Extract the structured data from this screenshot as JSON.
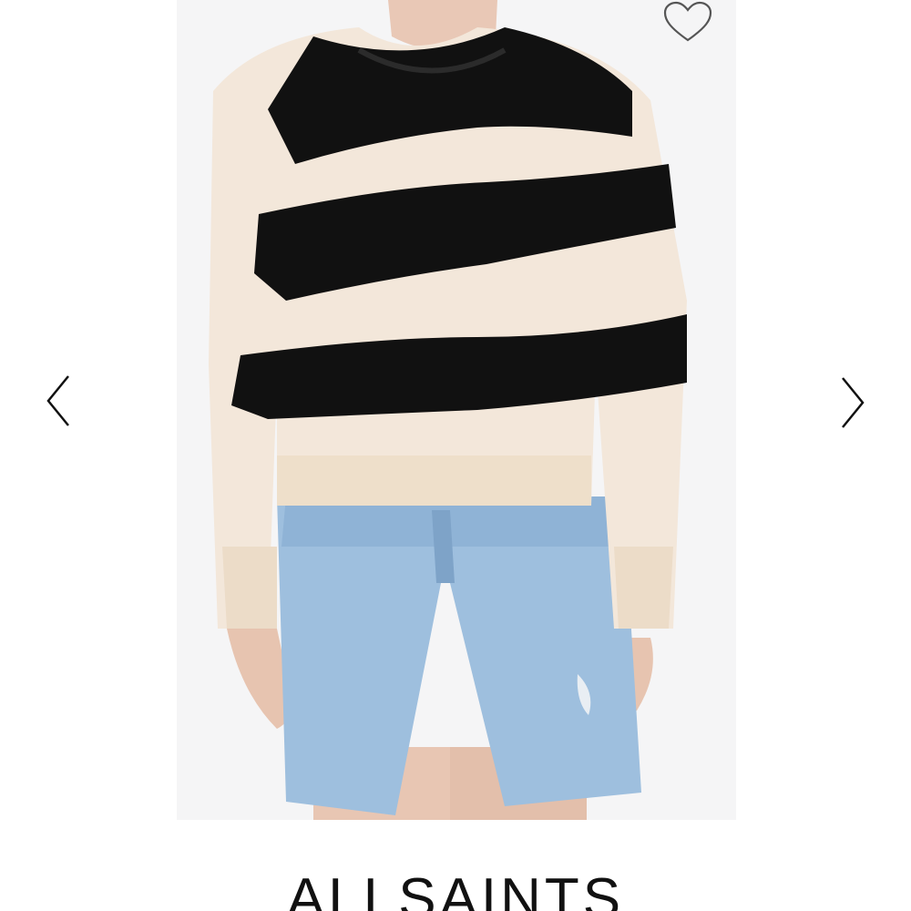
{
  "product": {
    "image_description_icon": "product-photo",
    "brand_name": "ALLSAINTS"
  },
  "gallery": {
    "prev_icon": "chevron-left-icon",
    "next_icon": "chevron-right-icon"
  },
  "wishlist": {
    "icon": "heart-icon"
  },
  "colors": {
    "stripe_dark": "#111111",
    "stripe_light": "#f3e7da",
    "denim": "#9dbfdd",
    "background": "#ffffff"
  }
}
